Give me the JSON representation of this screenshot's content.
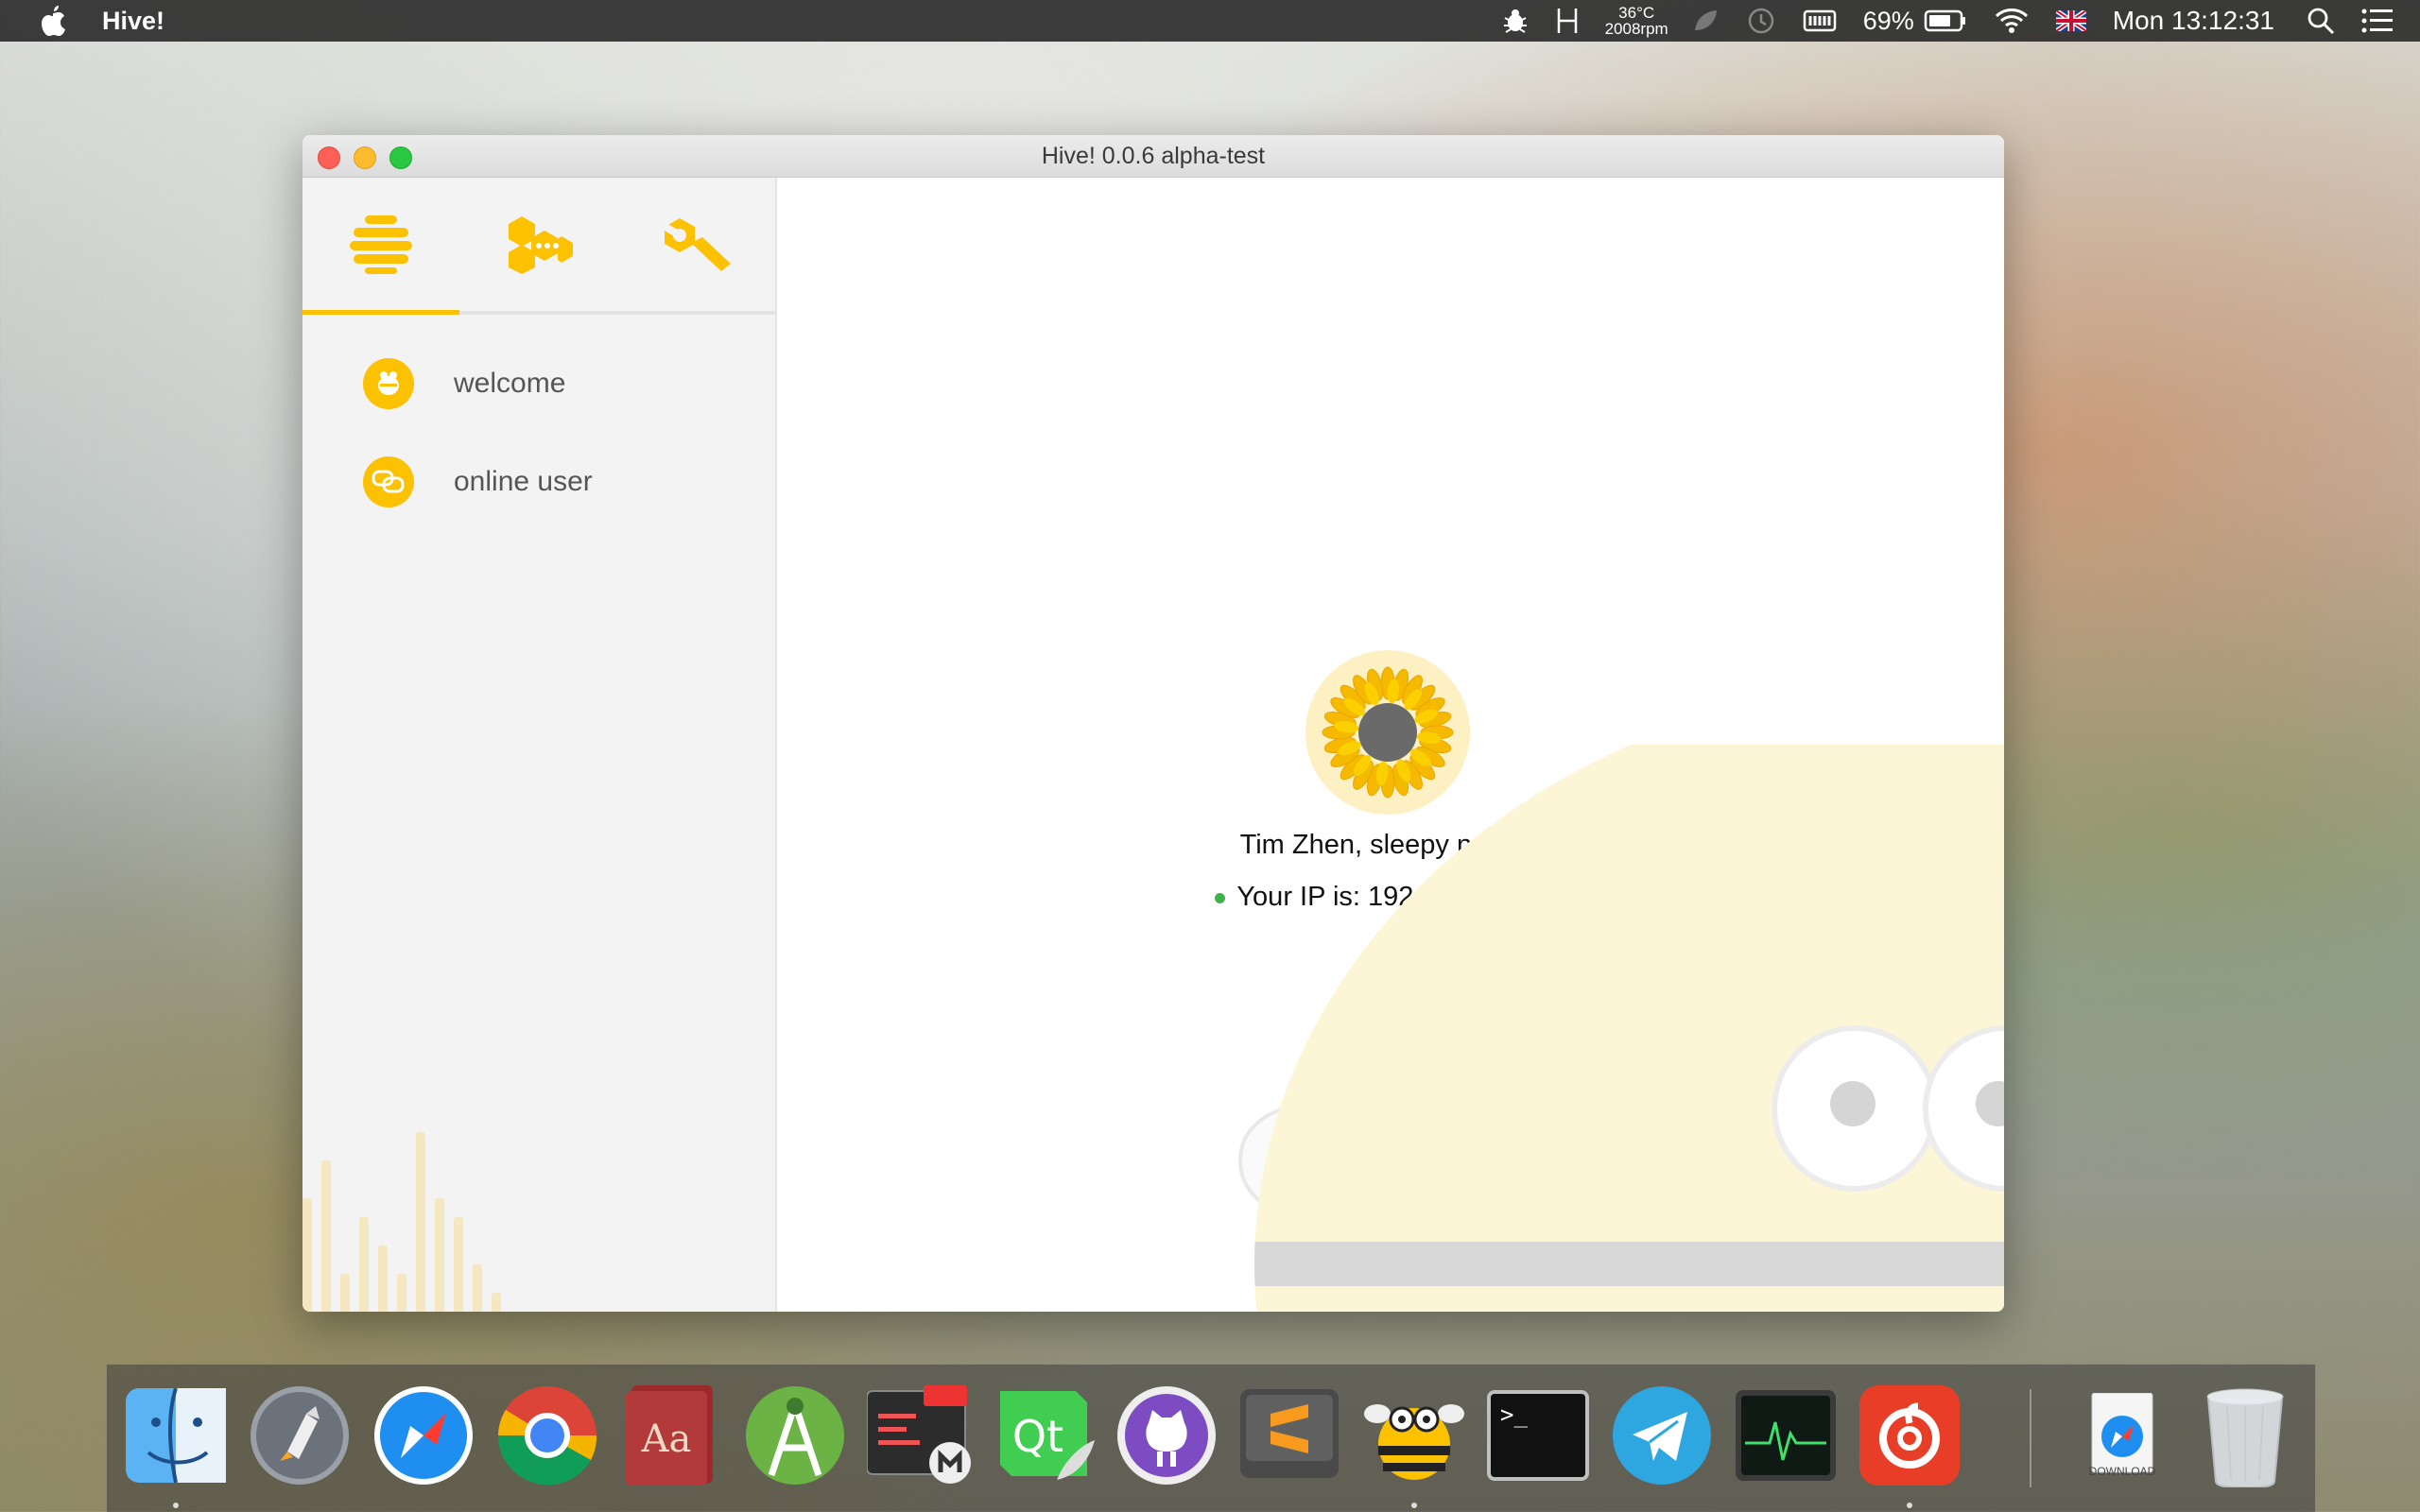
{
  "menubar": {
    "app_name": "Hive!",
    "temperature": "36°C",
    "fan": "2008rpm",
    "battery_percent": "69%",
    "clock": "Mon 13:12:31"
  },
  "window": {
    "title": "Hive! 0.0.6 alpha-test"
  },
  "sidebar": {
    "active_tab": "home",
    "items": [
      {
        "label": "welcome"
      },
      {
        "label": "online user"
      }
    ]
  },
  "main": {
    "greeting": "Tim Zhen, sleepy noon~",
    "ip_text": "Your IP is: 192.168.21.100"
  },
  "dock": {
    "apps": [
      "finder-icon",
      "launchpad-icon",
      "safari-icon",
      "chrome-icon",
      "dictionary-icon",
      "android-studio-icon",
      "liteide-icon",
      "qt-creator-icon",
      "github-desktop-icon",
      "sublime-text-icon",
      "hive-bee-icon",
      "terminal-icon",
      "telegram-icon",
      "activity-monitor-icon",
      "netease-music-icon",
      "downloads-folder-icon",
      "trash-icon"
    ],
    "download_label": "DOWNLOAD"
  },
  "colors": {
    "accent": "#fcc100",
    "status_online": "#3bb54a"
  }
}
